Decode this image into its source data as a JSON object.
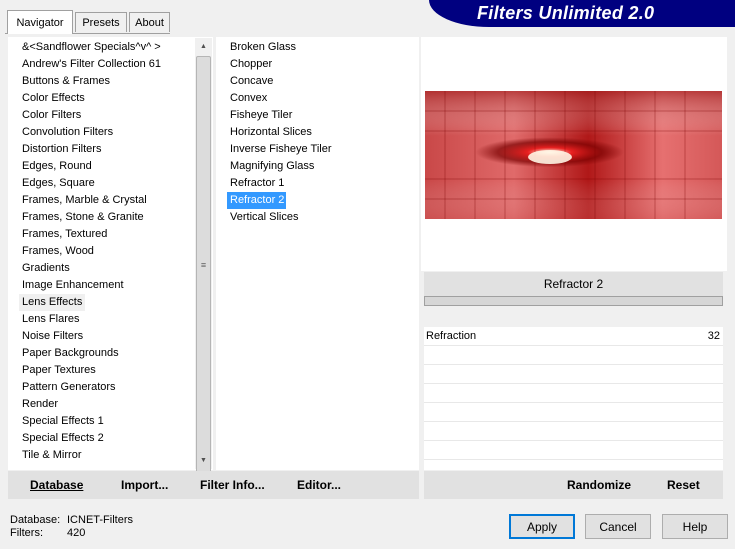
{
  "tabs": [
    {
      "label": "Navigator",
      "active": true
    },
    {
      "label": "Presets",
      "active": false
    },
    {
      "label": "About",
      "active": false
    }
  ],
  "banner_title": "Filters Unlimited 2.0",
  "categories": [
    "&<Sandflower Specials^v^ >",
    "Andrew's Filter Collection 61",
    "Buttons & Frames",
    "Color Effects",
    "Color Filters",
    "Convolution Filters",
    "Distortion Filters",
    "Edges, Round",
    "Edges, Square",
    "Frames, Marble & Crystal",
    "Frames, Stone & Granite",
    "Frames, Textured",
    "Frames, Wood",
    "Gradients",
    "Image Enhancement",
    "Lens Effects",
    "Lens Flares",
    "Noise Filters",
    "Paper Backgrounds",
    "Paper Textures",
    "Pattern Generators",
    "Render",
    "Special Effects 1",
    "Special Effects 2",
    "Tile & Mirror"
  ],
  "selected_category": "Lens Effects",
  "filters": [
    "Broken Glass",
    "Chopper",
    "Concave",
    "Convex",
    "Fisheye Tiler",
    "Horizontal Slices",
    "Inverse Fisheye Tiler",
    "Magnifying Glass",
    "Refractor 1",
    "Refractor 2",
    "Vertical Slices"
  ],
  "selected_filter": "Refractor 2",
  "left_toolbar": {
    "database": "Database",
    "import": "Import...",
    "filter_info": "Filter Info...",
    "editor": "Editor..."
  },
  "right_toolbar": {
    "randomize": "Randomize",
    "reset": "Reset"
  },
  "params": {
    "title": "Refractor 2",
    "items": [
      {
        "label": "Refraction",
        "value": "32"
      }
    ]
  },
  "status": {
    "database_label": "Database:",
    "database_value": "ICNET-Filters",
    "filters_label": "Filters:",
    "filters_value": "420"
  },
  "buttons": {
    "apply": "Apply",
    "cancel": "Cancel",
    "help": "Help"
  },
  "colors": {
    "selection": "#3399ff",
    "banner": "#000080"
  }
}
